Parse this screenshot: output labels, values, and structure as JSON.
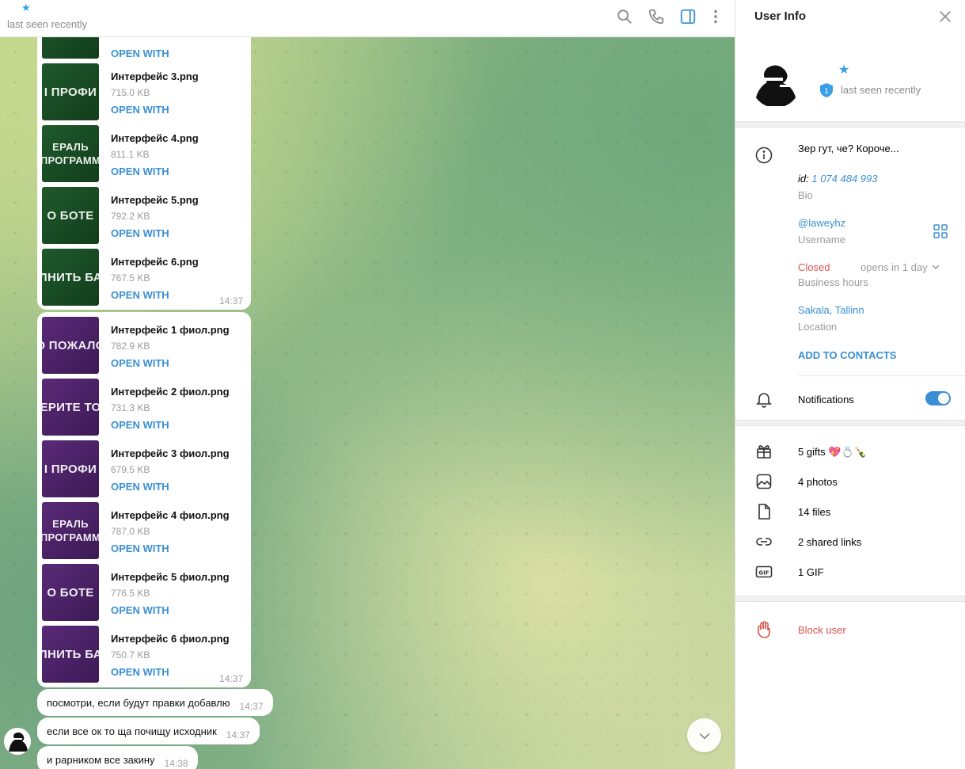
{
  "chat": {
    "header": {
      "star_icon": "star-icon",
      "status": "last seen recently"
    },
    "header_icons": [
      "search-icon",
      "phone-icon",
      "sidebar-toggle-icon",
      "more-vertical-icon"
    ],
    "file_bubbles": [
      {
        "time": "14:37",
        "files": [
          {
            "thumb_text": "",
            "thumb_color": "green",
            "name": "",
            "size": "",
            "action": "OPEN WITH"
          },
          {
            "thumb_text": "І ПРОФИ",
            "thumb_color": "green",
            "name": "Интерфейс 3.png",
            "size": "715.0 KB",
            "action": "OPEN WITH"
          },
          {
            "thumb_text": "ЕРАЛЬ\nПРОГРАММ",
            "thumb_color": "green",
            "name": "Интерфейс 4.png",
            "size": "811.1 KB",
            "action": "OPEN WITH"
          },
          {
            "thumb_text": "О БОТЕ",
            "thumb_color": "green",
            "name": "Интерфейс 5.png",
            "size": "792.2 KB",
            "action": "OPEN WITH"
          },
          {
            "thumb_text": "ЛНИТЬ БА",
            "thumb_color": "green",
            "name": "Интерфейс 6.png",
            "size": "767.5 KB",
            "action": "OPEN WITH"
          }
        ]
      },
      {
        "time": "14:37",
        "files": [
          {
            "thumb_text": "О ПОЖАЛО",
            "thumb_color": "purple",
            "name": "Интерфейс 1 фиол.png",
            "size": "782.9 KB",
            "action": "OPEN WITH"
          },
          {
            "thumb_text": "ЕРИТЕ ТО",
            "thumb_color": "purple",
            "name": "Интерфейс 2 фиол.png",
            "size": "731.3 KB",
            "action": "OPEN WITH"
          },
          {
            "thumb_text": "І ПРОФИ",
            "thumb_color": "purple",
            "name": "Интерфейс 3 фиол.png",
            "size": "679.5 KB",
            "action": "OPEN WITH"
          },
          {
            "thumb_text": "ЕРАЛЬ\nПРОГРАММ",
            "thumb_color": "purple",
            "name": "Интерфейс 4 фиол.png",
            "size": "787.0 KB",
            "action": "OPEN WITH"
          },
          {
            "thumb_text": "О БОТЕ",
            "thumb_color": "purple",
            "name": "Интерфейс 5 фиол.png",
            "size": "776.5 KB",
            "action": "OPEN WITH"
          },
          {
            "thumb_text": "ЛНИТЬ БА",
            "thumb_color": "purple",
            "name": "Интерфейс 6 фиол.png",
            "size": "750.7 KB",
            "action": "OPEN WITH"
          }
        ]
      }
    ],
    "messages": [
      {
        "text": "посмотри, если будут правки добавлю",
        "time": "14:37"
      },
      {
        "text": "если все ок то ща почищу исходник",
        "time": "14:37"
      },
      {
        "text": "и рарником все закину",
        "time": "14:38"
      }
    ]
  },
  "panel": {
    "title": "User Info",
    "status": "last seen recently",
    "badge_number": "1",
    "bio": {
      "text": "Зер гут, че? Короче...",
      "id_label": "id:",
      "id_value": "1 074 484 993",
      "caption": "Bio"
    },
    "username": {
      "value": "@laweyhz",
      "caption": "Username"
    },
    "business_hours": {
      "state": "Closed",
      "detail": "opens in 1 day",
      "caption": "Business hours"
    },
    "location": {
      "value": "Sakala, Tallinn",
      "caption": "Location"
    },
    "add_contacts": "ADD TO CONTACTS",
    "notifications": {
      "label": "Notifications",
      "enabled": true
    },
    "media": {
      "gifts": "5 gifts",
      "gift_emojis": "💖💍🍾",
      "photos": "4 photos",
      "files": "14 files",
      "links": "2 shared links",
      "gif": "1 GIF"
    },
    "block": "Block user",
    "colors": {
      "accent": "#3a8fd4",
      "danger": "#d9534f",
      "muted": "#9a9a9a"
    }
  }
}
